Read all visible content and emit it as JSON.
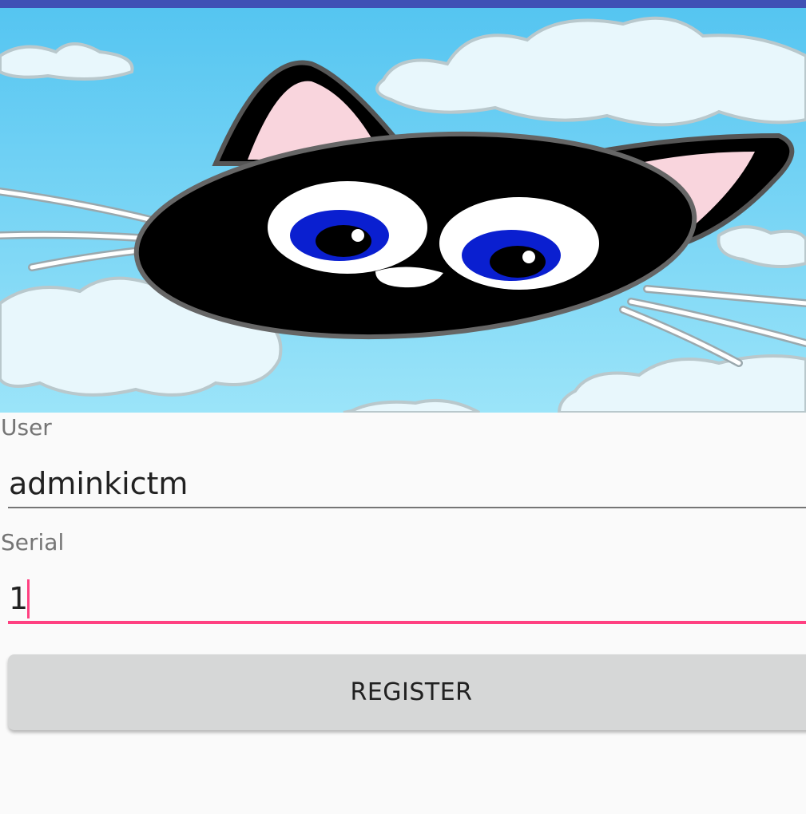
{
  "theme": {
    "primary": "#3f51b5",
    "accent": "#ff4081",
    "background": "#fafafa",
    "button_background": "#d6d7d7"
  },
  "banner": {
    "image": "cartoon-black-cat-in-clouds",
    "sky_color": "#5bc8f0"
  },
  "form": {
    "user": {
      "label": "User",
      "value": "adminkictm"
    },
    "serial": {
      "label": "Serial",
      "value": "1",
      "focused": true
    },
    "register_label": "REGISTER"
  }
}
